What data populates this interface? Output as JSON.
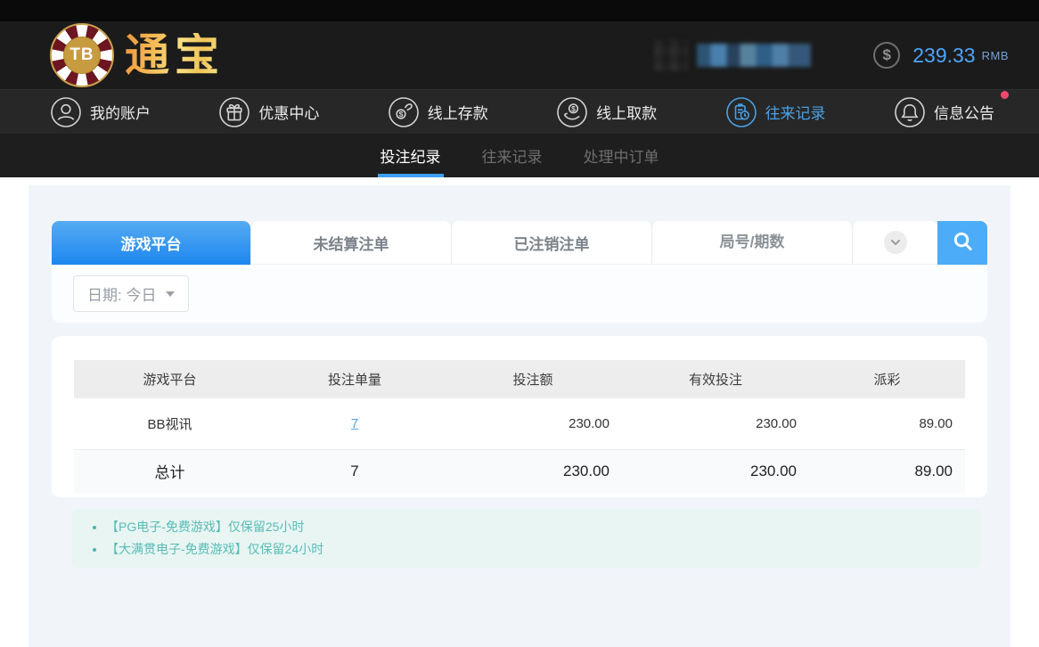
{
  "header": {
    "logo": {
      "badge": "TB",
      "brand": "通宝"
    },
    "account": {
      "balance": "239.33",
      "currency": "RMB",
      "currency_symbol": "$"
    }
  },
  "nav": {
    "items": [
      {
        "label": "我的账户",
        "icon": "user-icon",
        "active": false
      },
      {
        "label": "优惠中心",
        "icon": "gift-icon",
        "active": false
      },
      {
        "label": "线上存款",
        "icon": "deposit-hand-coin-icon",
        "active": false
      },
      {
        "label": "线上取款",
        "icon": "withdraw-hand-coin-icon",
        "active": false
      },
      {
        "label": "往来记录",
        "icon": "records-clipboard-icon",
        "active": true
      },
      {
        "label": "信息公告",
        "icon": "bell-icon",
        "active": false,
        "has_notification_dot": true
      }
    ]
  },
  "subnav": {
    "items": [
      {
        "label": "投注纪录",
        "active": true
      },
      {
        "label": "往来记录",
        "active": false
      },
      {
        "label": "处理中订单",
        "active": false
      }
    ]
  },
  "tabs": {
    "items": [
      {
        "label": "游戏平台",
        "active": true
      },
      {
        "label": "未结算注单",
        "active": false
      },
      {
        "label": "已注销注单",
        "active": false
      }
    ],
    "search_placeholder": "局号/期数",
    "expand_icon": "chevron-down-icon",
    "search_icon": "magnifier-icon"
  },
  "filter": {
    "date_label": "日期: 今日"
  },
  "table": {
    "headers": [
      "游戏平台",
      "投注单量",
      "投注额",
      "有效投注",
      "派彩"
    ],
    "rows": [
      {
        "platform": "BB视讯",
        "bet_count": "7",
        "bet_amount": "230.00",
        "valid_bet": "230.00",
        "payout": "89.00"
      }
    ],
    "total": {
      "label": "总计",
      "bet_count": "7",
      "bet_amount": "230.00",
      "valid_bet": "230.00",
      "payout": "89.00"
    }
  },
  "notes": {
    "items": [
      "【PG电子-免费游戏】仅保留25小时",
      "【大满贯电子-免费游戏】仅保留24小时"
    ]
  },
  "colors": {
    "accent_blue": "#3d9ef2",
    "active_nav_blue": "#4aa0e4",
    "tab_gradient_top": "#56abf3",
    "tab_gradient_bottom": "#1d87ef",
    "search_button_blue": "#4cacf7",
    "balance_blue": "#4ca5f9",
    "brand_gold": "#f5bb55",
    "chip_red": "#6d1520",
    "note_teal": "#58bcb7",
    "alert_dot_pink": "#f3476b"
  }
}
